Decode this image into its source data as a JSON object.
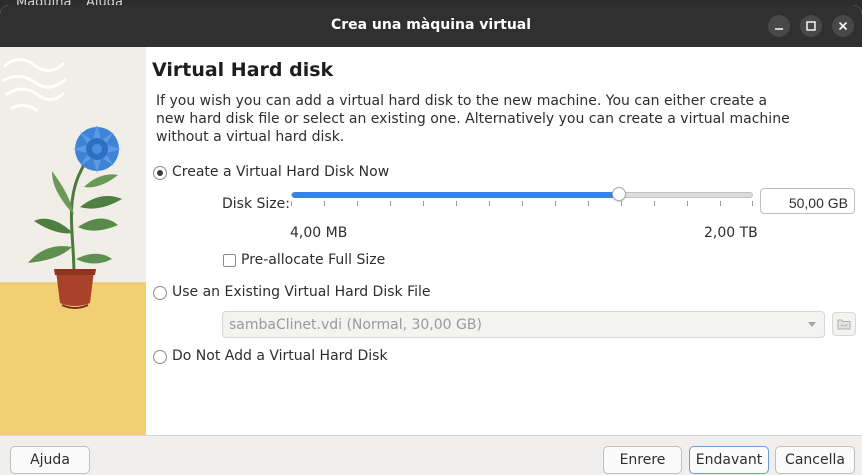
{
  "background_menu": {
    "item1": "Màquina",
    "item2": "Ajuda"
  },
  "window": {
    "title": "Crea una màquina virtual"
  },
  "page": {
    "heading": "Virtual Hard disk",
    "description": "If you wish you can add a virtual hard disk to the new machine. You can either create a new hard disk file or select an existing one. Alternatively you can create a virtual machine without a virtual hard disk."
  },
  "options": {
    "create_now": {
      "label": "Create a Virtual Hard Disk Now",
      "selected": true
    },
    "use_existing": {
      "label": "Use an Existing Virtual Hard Disk File",
      "selected": false
    },
    "do_not_add": {
      "label": "Do Not Add a Virtual Hard Disk",
      "selected": false
    }
  },
  "disk_size": {
    "label": "Disk Size:",
    "value": "50,00 GB",
    "min_label": "4,00 MB",
    "max_label": "2,00 TB",
    "slider_fraction": 0.71
  },
  "preallocate": {
    "label": "Pre-allocate Full Size",
    "checked": false
  },
  "existing_file": {
    "selected": "sambaClinet.vdi (Normal, 30,00 GB)",
    "enabled": false
  },
  "buttons": {
    "help": "Ajuda",
    "back": "Enrere",
    "next": "Endavant",
    "cancel": "Cancella"
  },
  "colors": {
    "accent": "#3584e4",
    "titlebar": "#303030",
    "flower": "#3f83d6",
    "pot": "#a8432a",
    "ground": "#f3cf73"
  },
  "icons": {
    "minimize": "minimize-icon",
    "maximize": "maximize-icon",
    "close": "close-icon",
    "folder": "folder-icon",
    "dropdown": "chevron-down-icon"
  }
}
